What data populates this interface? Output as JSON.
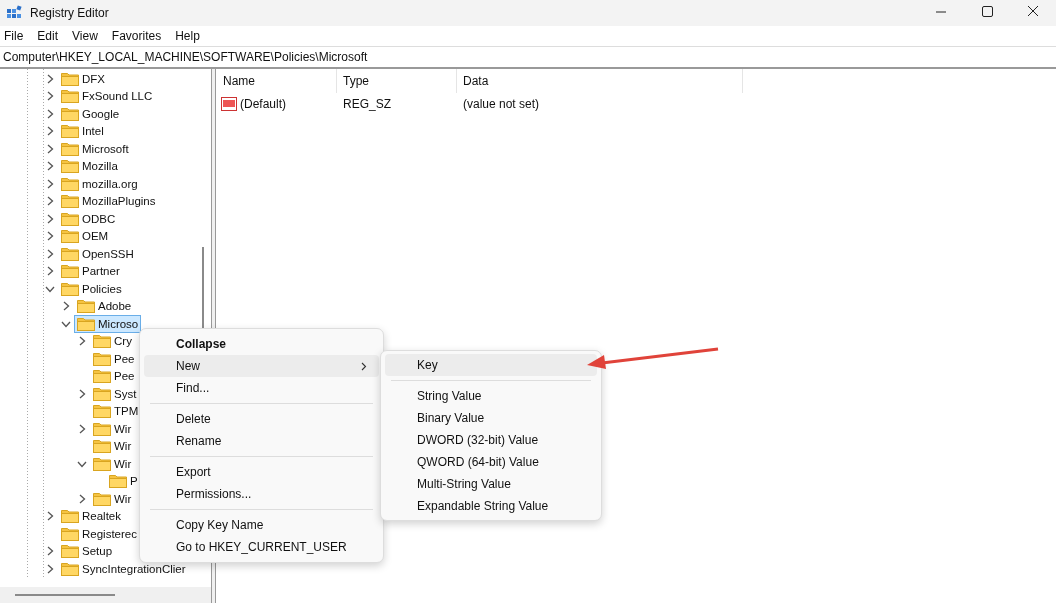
{
  "window": {
    "title": "Registry Editor"
  },
  "menu_bar": [
    "File",
    "Edit",
    "View",
    "Favorites",
    "Help"
  ],
  "address": "Computer\\HKEY_LOCAL_MACHINE\\SOFTWARE\\Policies\\Microsoft",
  "tree": {
    "items": [
      {
        "label": "DFX",
        "expanded": false,
        "selected": false
      },
      {
        "label": "FxSound LLC",
        "expanded": false,
        "selected": false
      },
      {
        "label": "Google",
        "expanded": false,
        "selected": false
      },
      {
        "label": "Intel",
        "expanded": false,
        "selected": false
      },
      {
        "label": "Microsoft",
        "expanded": false,
        "selected": false
      },
      {
        "label": "Mozilla",
        "expanded": false,
        "selected": false
      },
      {
        "label": "mozilla.org",
        "expanded": false,
        "selected": false
      },
      {
        "label": "MozillaPlugins",
        "expanded": false,
        "selected": false
      },
      {
        "label": "ODBC",
        "expanded": false,
        "selected": false
      },
      {
        "label": "OEM",
        "expanded": false,
        "selected": false
      },
      {
        "label": "OpenSSH",
        "expanded": false,
        "selected": false
      },
      {
        "label": "Partner",
        "expanded": false,
        "selected": false
      },
      {
        "label": "Policies",
        "expanded": true,
        "selected": false,
        "children": [
          {
            "label": "Adobe",
            "expanded": false,
            "selected": false
          },
          {
            "label": "Microso",
            "expanded": true,
            "selected": true,
            "children": [
              {
                "label": "Cry",
                "expanded": false,
                "selected": false
              },
              {
                "label": "Pee",
                "selected": false
              },
              {
                "label": "Pee",
                "selected": false
              },
              {
                "label": "Syst",
                "expanded": false,
                "selected": false
              },
              {
                "label": "TPM",
                "selected": false
              },
              {
                "label": "Wir",
                "expanded": false,
                "selected": false
              },
              {
                "label": "Wir",
                "selected": false
              },
              {
                "label": "Wir",
                "expanded": true,
                "selected": false,
                "children": [
                  {
                    "label": "P",
                    "selected": false
                  }
                ]
              },
              {
                "label": "Wir",
                "expanded": false,
                "selected": false
              }
            ]
          }
        ]
      },
      {
        "label": "Realtek",
        "expanded": false,
        "selected": false
      },
      {
        "label": "Registerec",
        "selected": false
      },
      {
        "label": "Setup",
        "expanded": false,
        "selected": false
      },
      {
        "label": "SyncIntegrationClier",
        "expanded": false,
        "selected": false
      }
    ]
  },
  "values": {
    "columns": [
      "Name",
      "Type",
      "Data"
    ],
    "rows": [
      {
        "name": "(Default)",
        "type": "REG_SZ",
        "data": "(value not set)"
      }
    ]
  },
  "context_menu": [
    {
      "kind": "item",
      "label": "Collapse",
      "bold": true,
      "submenu": false,
      "selected": false
    },
    {
      "kind": "item",
      "label": "New",
      "bold": false,
      "submenu": true,
      "selected": true
    },
    {
      "kind": "item",
      "label": "Find...",
      "bold": false,
      "submenu": false,
      "selected": false
    },
    {
      "kind": "separator"
    },
    {
      "kind": "item",
      "label": "Delete",
      "bold": false,
      "submenu": false,
      "selected": false
    },
    {
      "kind": "item",
      "label": "Rename",
      "bold": false,
      "submenu": false,
      "selected": false
    },
    {
      "kind": "separator"
    },
    {
      "kind": "item",
      "label": "Export",
      "bold": false,
      "submenu": false,
      "selected": false
    },
    {
      "kind": "item",
      "label": "Permissions...",
      "bold": false,
      "submenu": false,
      "selected": false
    },
    {
      "kind": "separator"
    },
    {
      "kind": "item",
      "label": "Copy Key Name",
      "bold": false,
      "submenu": false,
      "selected": false
    },
    {
      "kind": "item",
      "label": "Go to HKEY_CURRENT_USER",
      "bold": false,
      "submenu": false,
      "selected": false
    }
  ],
  "submenu": [
    {
      "kind": "item",
      "label": "Key",
      "selected": true
    },
    {
      "kind": "separator"
    },
    {
      "kind": "item",
      "label": "String Value",
      "selected": false
    },
    {
      "kind": "item",
      "label": "Binary Value",
      "selected": false
    },
    {
      "kind": "item",
      "label": "DWORD (32-bit) Value",
      "selected": false
    },
    {
      "kind": "item",
      "label": "QWORD (64-bit) Value",
      "selected": false
    },
    {
      "kind": "item",
      "label": "Multi-String Value",
      "selected": false
    },
    {
      "kind": "item",
      "label": "Expandable String Value",
      "selected": false
    }
  ]
}
